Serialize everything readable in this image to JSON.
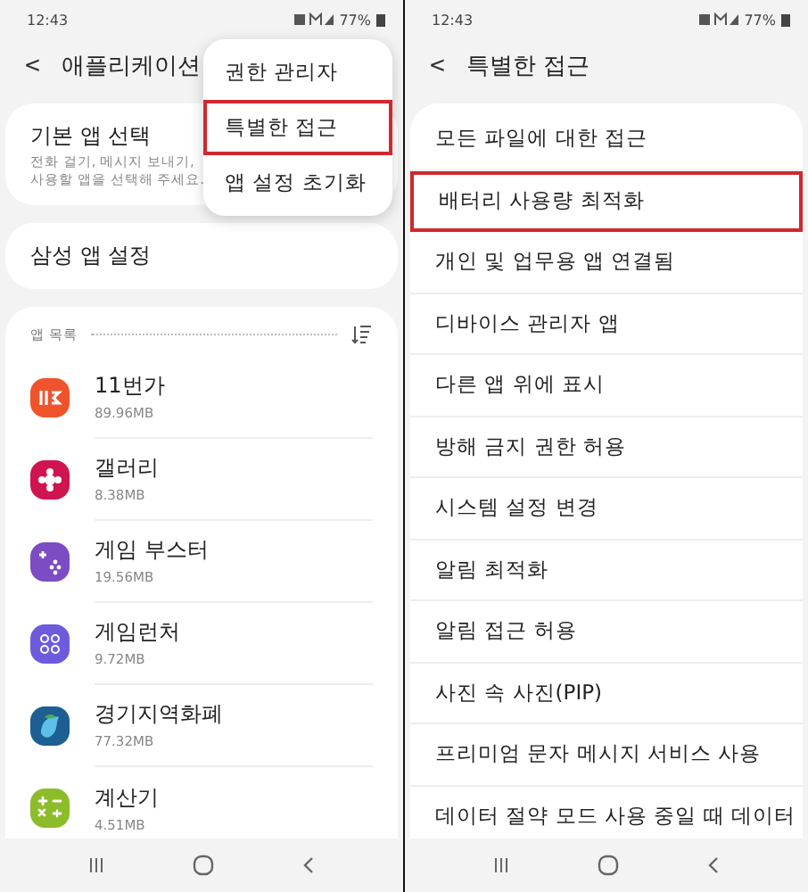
{
  "left_screen": {
    "status_bar": {
      "time": "12:43",
      "battery": "77%"
    },
    "header": {
      "back": "<",
      "title": "애플리케이션"
    },
    "default_apps": {
      "title": "기본 앱 선택",
      "subtitle_lines": [
        "전화 걸기, 메시지 보내기,",
        "사용할 앱을 선택해 주세요."
      ]
    },
    "samsung_settings": {
      "title": "삼성 앱 설정"
    },
    "app_list": {
      "heading": "앱 목록",
      "apps": [
        {
          "name": "11번가",
          "size": "89.96MB",
          "kind": "store",
          "color": "#f0532b"
        },
        {
          "name": "갤러리",
          "size": "8.38MB",
          "kind": "gallery",
          "color": "#cf1450"
        },
        {
          "name": "게임 부스터",
          "size": "19.56MB",
          "kind": "booster",
          "color": "#7b4cc4"
        },
        {
          "name": "게임런처",
          "size": "9.72MB",
          "kind": "launcher",
          "color": "#6c5bdc"
        },
        {
          "name": "경기지역화폐",
          "size": "77.32MB",
          "kind": "wallet",
          "color": "#1d5f92"
        },
        {
          "name": "계산기",
          "size": "4.51MB",
          "kind": "calculator",
          "color": "#8cbc2a"
        }
      ]
    },
    "menu": [
      {
        "label": "권한 관리자",
        "highlighted": false
      },
      {
        "label": "특별한 접근",
        "highlighted": true
      },
      {
        "label": "앱 설정 초기화",
        "highlighted": false
      }
    ]
  },
  "right_screen": {
    "status_bar": {
      "time": "12:43",
      "battery": "77%"
    },
    "header": {
      "back": "<",
      "title": "특별한 접근"
    },
    "items": [
      {
        "label": "모든 파일에 대한 접근",
        "highlighted": false
      },
      {
        "label": "배터리 사용량 최적화",
        "highlighted": true
      },
      {
        "label": "개인 및 업무용 앱 연결됨",
        "highlighted": false
      },
      {
        "label": "디바이스 관리자 앱",
        "highlighted": false
      },
      {
        "label": "다른 앱 위에 표시",
        "highlighted": false
      },
      {
        "label": "방해 금지 권한 허용",
        "highlighted": false
      },
      {
        "label": "시스템 설정 변경",
        "highlighted": false
      },
      {
        "label": "알림 최적화",
        "highlighted": false
      },
      {
        "label": "알림 접근 허용",
        "highlighted": false
      },
      {
        "label": "사진 속 사진(PIP)",
        "highlighted": false
      },
      {
        "label": "프리미엄 문자 메시지 서비스 사용",
        "highlighted": false
      },
      {
        "label": "데이터 절약 모드 사용 중일 때 데이터",
        "highlighted": false
      }
    ]
  }
}
